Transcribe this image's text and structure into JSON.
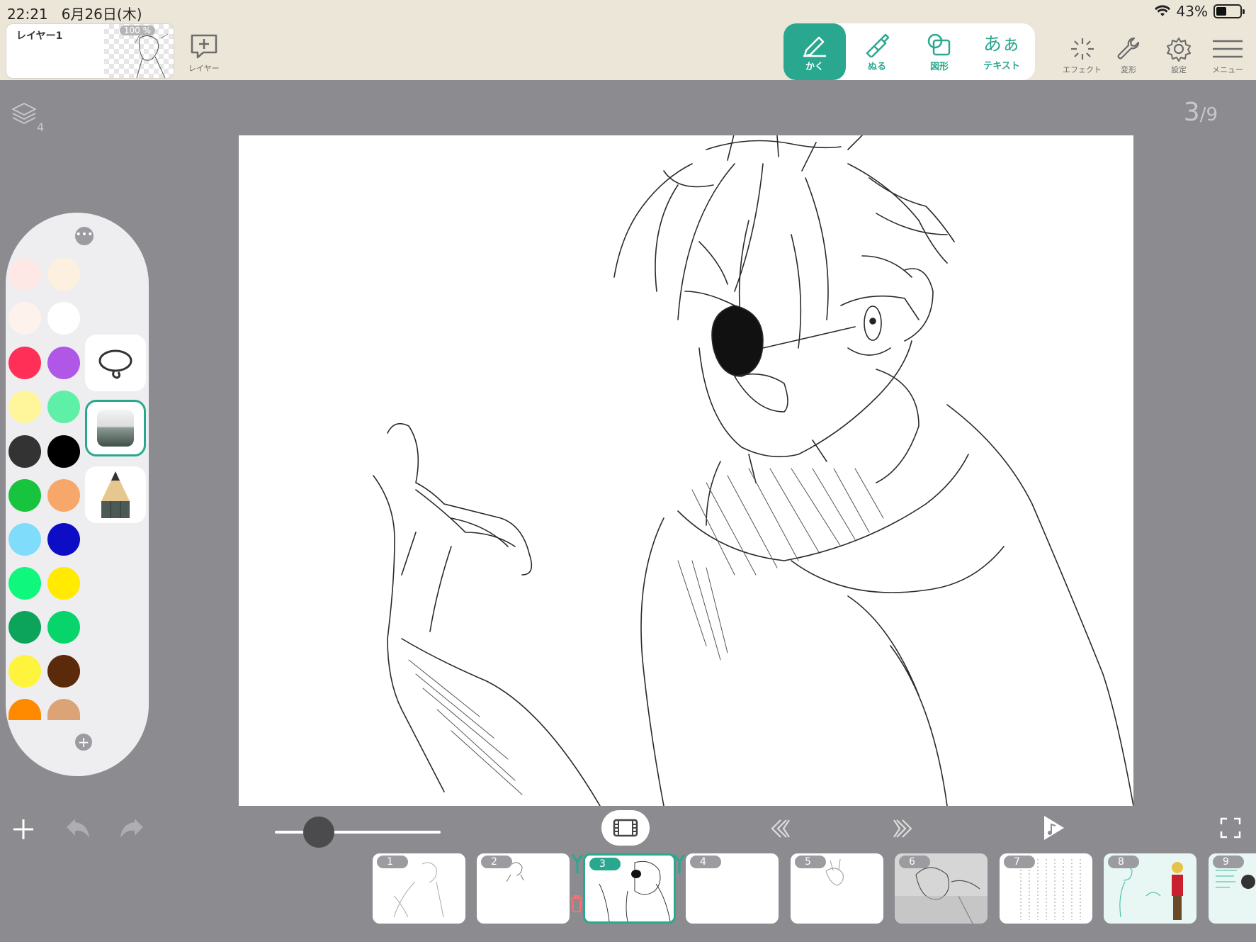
{
  "status": {
    "time": "22:21",
    "date": "6月26日(木)",
    "battery": "43%"
  },
  "layer": {
    "name": "レイヤー1",
    "opacity": "100 %",
    "add_label": "レイヤー"
  },
  "modes": [
    {
      "label": "かく",
      "active": true
    },
    {
      "label": "ぬる",
      "active": false
    },
    {
      "label": "図形",
      "active": false
    },
    {
      "label": "テキスト",
      "active": false
    }
  ],
  "text_mode_glyph": "あぁ",
  "right_tools": {
    "effect": "エフェクト",
    "transform": "変形",
    "settings": "設定",
    "menu": "メニュー"
  },
  "layers_count": "4",
  "page": {
    "current": "3",
    "total": "9"
  },
  "palette": {
    "colors": [
      "#fde8e6",
      "#fdf0de",
      "#fdf2ec",
      "#ffffff",
      "#ff2f57",
      "#b057e8",
      "#fff59a",
      "#5ff0a8",
      "#333333",
      "#000000",
      "#18c43e",
      "#f8a76a",
      "#7fdcfb",
      "#0d0dc6",
      "#0ff77d",
      "#ffea00",
      "#0ba45a",
      "#07d56c",
      "#fff43d",
      "#5a2a0a",
      "#ff8a00",
      "#dca377"
    ]
  },
  "frames": [
    {
      "num": "1"
    },
    {
      "num": "2"
    },
    {
      "num": "3"
    },
    {
      "num": "4"
    },
    {
      "num": "5"
    },
    {
      "num": "6"
    },
    {
      "num": "7"
    },
    {
      "num": "8"
    },
    {
      "num": "9"
    }
  ],
  "accent": "#2aa88f"
}
